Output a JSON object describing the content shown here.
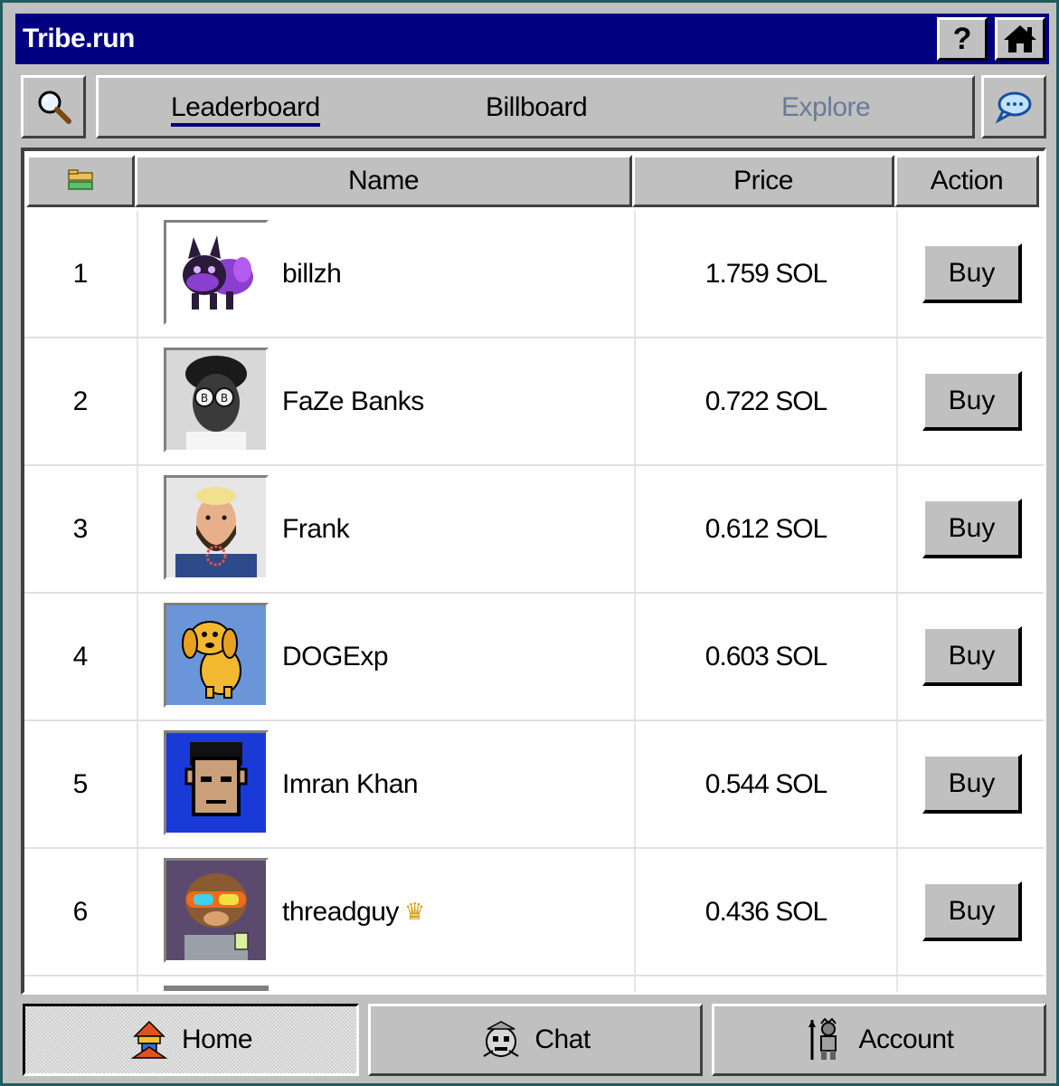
{
  "titlebar": {
    "title": "Tribe.run",
    "help_label": "?",
    "home_icon": "house-icon"
  },
  "nav": {
    "search_icon": "magnifier-icon",
    "chat_icon": "speech-bubble-icon",
    "tabs": [
      {
        "label": "Leaderboard",
        "state": "active"
      },
      {
        "label": "Billboard",
        "state": "normal"
      },
      {
        "label": "Explore",
        "state": "dimmed"
      }
    ]
  },
  "table": {
    "sort_icon": "folder-sort-icon",
    "columns": {
      "name": "Name",
      "price": "Price",
      "action": "Action"
    },
    "rows": [
      {
        "rank": "1",
        "name": "billzh",
        "price": "1.759 SOL",
        "action": "Buy",
        "avatar": "purple-cat-avatar"
      },
      {
        "rank": "2",
        "name": "FaZe Banks",
        "price": "0.722 SOL",
        "action": "Buy",
        "avatar": "man-with-glasses-avatar"
      },
      {
        "rank": "3",
        "name": "Frank",
        "price": "0.612 SOL",
        "action": "Buy",
        "avatar": "bearded-man-avatar"
      },
      {
        "rank": "4",
        "name": "DOGExp",
        "price": "0.603 SOL",
        "action": "Buy",
        "avatar": "yellow-dog-avatar"
      },
      {
        "rank": "5",
        "name": "Imran Khan",
        "price": "0.544 SOL",
        "action": "Buy",
        "avatar": "pixel-face-avatar"
      },
      {
        "rank": "6",
        "name": "threadguy",
        "price": "0.436 SOL",
        "action": "Buy",
        "avatar": "monkey-goggles-avatar",
        "badge": "crown-icon"
      }
    ]
  },
  "bottom_nav": [
    {
      "label": "Home",
      "icon": "tribal-totem-icon",
      "state": "active"
    },
    {
      "label": "Chat",
      "icon": "tribal-mask-icon",
      "state": "normal"
    },
    {
      "label": "Account",
      "icon": "warrior-icon",
      "state": "normal"
    }
  ]
}
